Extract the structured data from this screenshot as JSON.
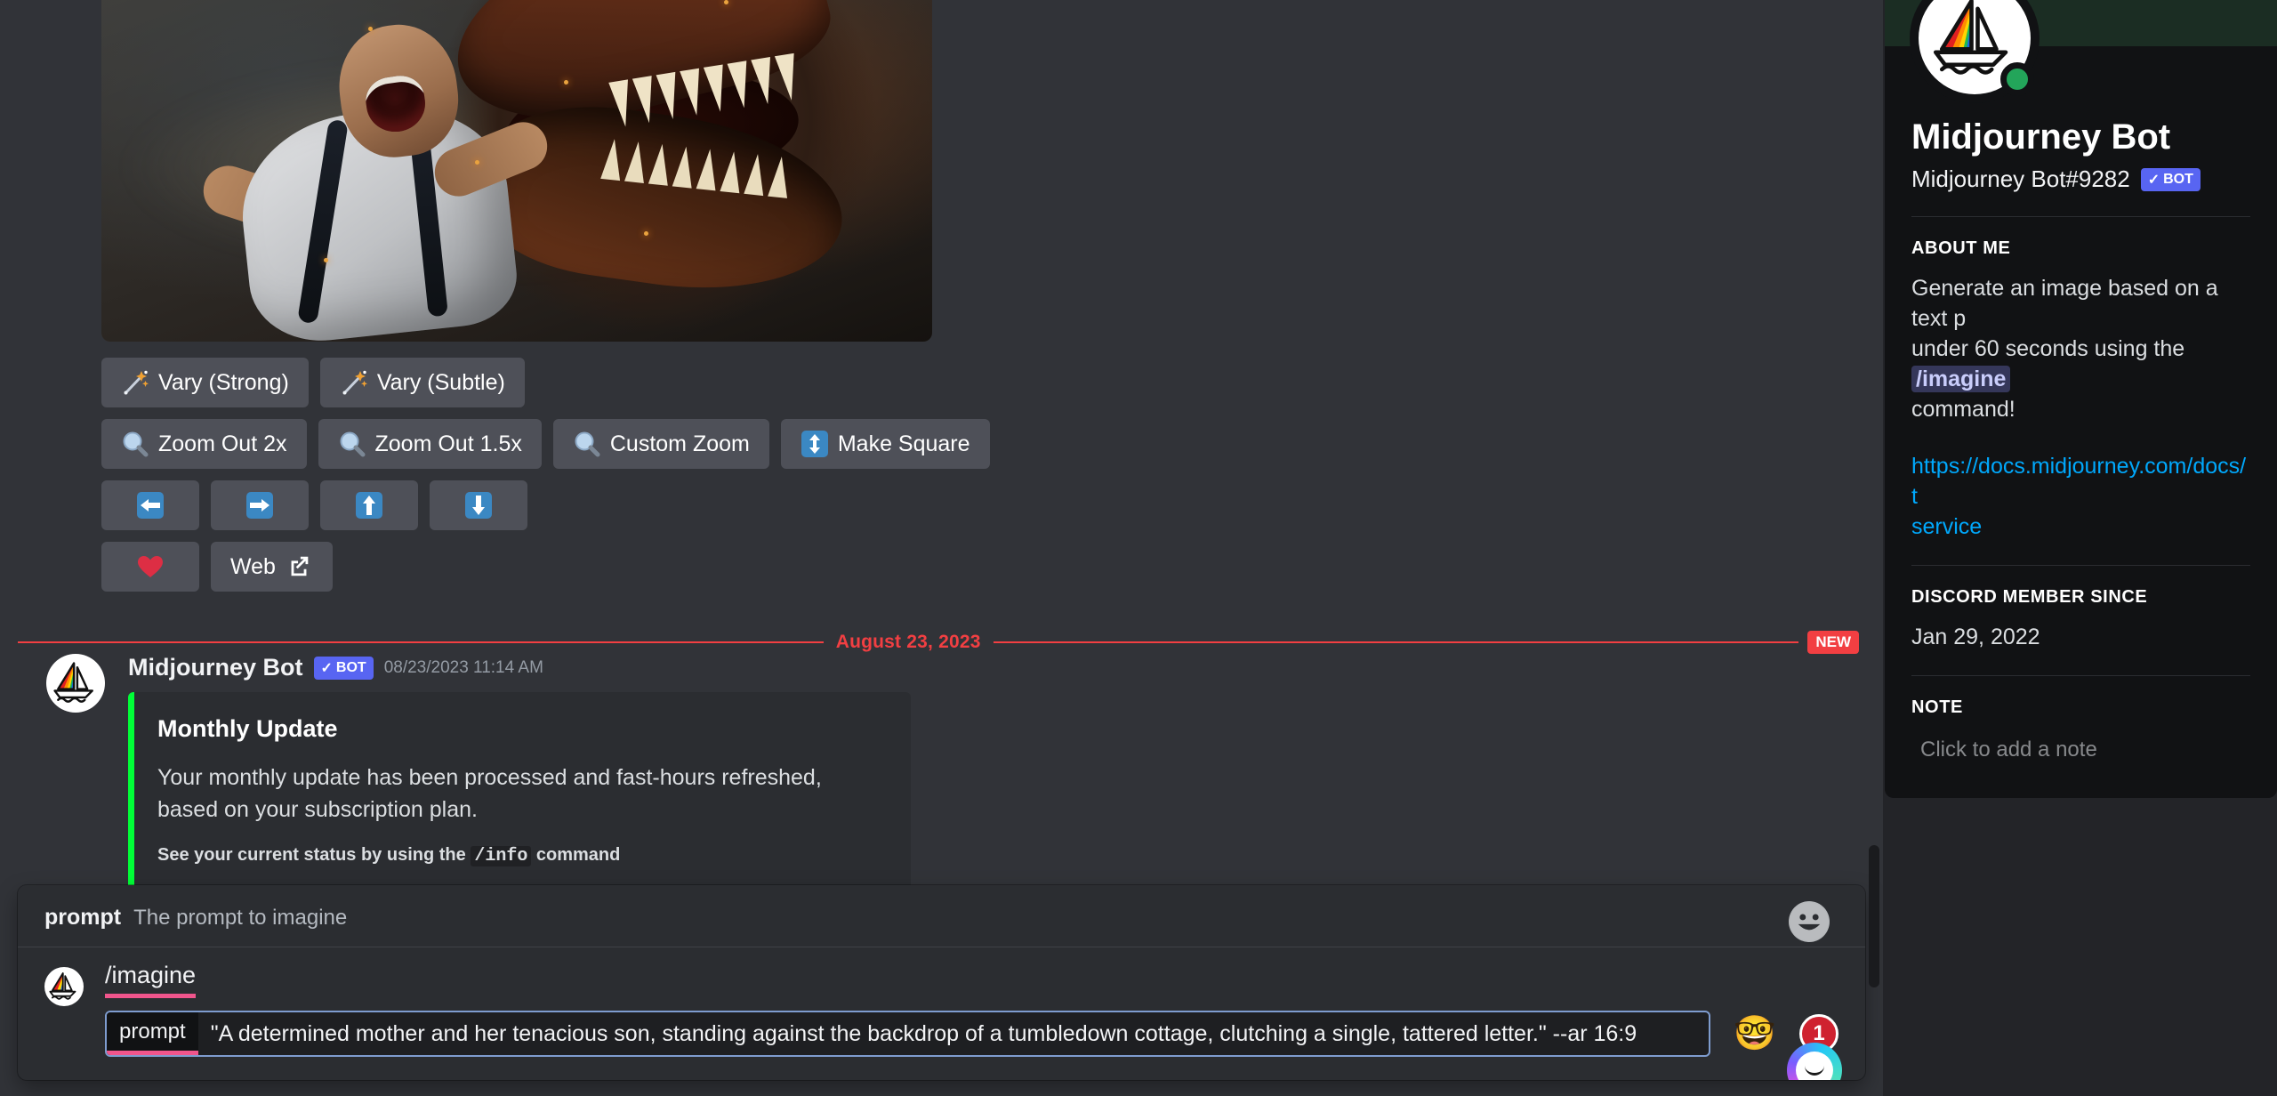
{
  "message_actions": {
    "rows": [
      [
        {
          "id": "vary-strong",
          "icon": "magic-wand-icon",
          "label": "Vary (Strong)"
        },
        {
          "id": "vary-subtle",
          "icon": "magic-wand-icon",
          "label": "Vary (Subtle)"
        }
      ],
      [
        {
          "id": "zoom-out-2x",
          "icon": "magnifier-icon",
          "label": "Zoom Out 2x"
        },
        {
          "id": "zoom-out-15x",
          "icon": "magnifier-icon",
          "label": "Zoom Out 1.5x"
        },
        {
          "id": "custom-zoom",
          "icon": "magnifier-icon",
          "label": "Custom Zoom"
        },
        {
          "id": "make-square",
          "icon": "up-down-arrow-icon",
          "label": "Make Square"
        }
      ],
      [
        {
          "id": "pan-left",
          "icon": "arrow-left-icon",
          "label": ""
        },
        {
          "id": "pan-right",
          "icon": "arrow-right-icon",
          "label": ""
        },
        {
          "id": "pan-up",
          "icon": "arrow-up-icon",
          "label": ""
        },
        {
          "id": "pan-down",
          "icon": "arrow-down-icon",
          "label": ""
        }
      ],
      [
        {
          "id": "favorite",
          "icon": "heart-icon",
          "label": ""
        },
        {
          "id": "web",
          "icon": "external-link-icon",
          "label": "Web"
        }
      ]
    ]
  },
  "date_divider": {
    "label": "August 23, 2023",
    "new_badge": "NEW",
    "color": "#f23f42"
  },
  "message": {
    "author": "Midjourney Bot",
    "bot_tag": "BOT",
    "timestamp": "08/23/2023 11:14 AM",
    "embed": {
      "accent_color": "#00ff37",
      "title": "Monthly Update",
      "description": "Your monthly update has been processed and fast-hours refreshed, based on your subscription plan.",
      "footer_prefix": "See your current status by using the ",
      "footer_code": "/info",
      "footer_suffix": " command"
    }
  },
  "command_popup": {
    "hint_key": "prompt",
    "hint_desc": "The prompt to imagine",
    "command_name": "/imagine",
    "param_label": "prompt",
    "param_value": "\"A determined mother and her tenacious son, standing against the backdrop of a tumbledown cottage, clutching a single, tattered letter.\" --ar 16:9",
    "nerd_emoji": "🤓",
    "count_badge": "1",
    "emoji_picker": "emoji-picker-icon"
  },
  "profile": {
    "name": "Midjourney Bot",
    "handle": "Midjourney Bot#9282",
    "bot_tag": "BOT",
    "status": "online",
    "sections": [
      {
        "id": "about-me",
        "title": "ABOUT ME",
        "text_part1": "Generate an image based on a text p",
        "text_part2": "under 60 seconds using the ",
        "code": "/imagine",
        "text_part3": "command!"
      },
      {
        "id": "links",
        "link_line1": "https://docs.midjourney.com/docs/t",
        "link_line2": "service"
      },
      {
        "id": "member-since",
        "title": "DISCORD MEMBER SINCE",
        "value": "Jan 29, 2022"
      },
      {
        "id": "note",
        "title": "NOTE",
        "placeholder": "Click to add a note"
      }
    ]
  },
  "colors": {
    "discord_blurple": "#5865f2",
    "embed_accent": "#00ff37",
    "divider_red": "#f23f42",
    "link_blue": "#00a8fc",
    "online_green": "#23a55a",
    "button_gray": "#4e5058"
  }
}
